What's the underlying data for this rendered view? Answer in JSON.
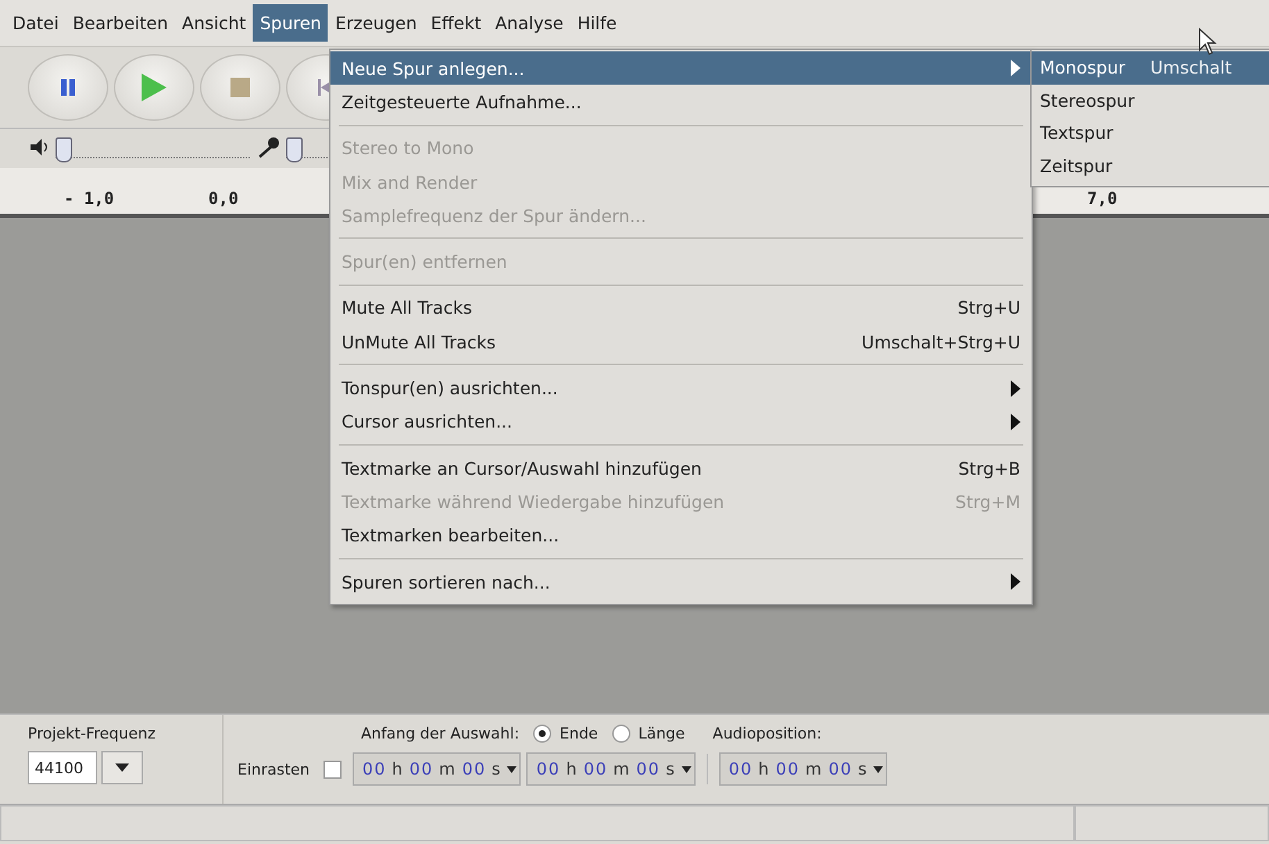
{
  "menubar": [
    {
      "label": "Datei",
      "selected": false
    },
    {
      "label": "Bearbeiten",
      "selected": false
    },
    {
      "label": "Ansicht",
      "selected": false
    },
    {
      "label": "Spuren",
      "selected": true
    },
    {
      "label": "Erzeugen",
      "selected": false
    },
    {
      "label": "Effekt",
      "selected": false
    },
    {
      "label": "Analyse",
      "selected": false
    },
    {
      "label": "Hilfe",
      "selected": false
    }
  ],
  "meters": [
    {
      "kind": "speaker",
      "level": 0
    },
    {
      "kind": "microphone",
      "level": 0
    }
  ],
  "ruler": [
    "- 1,0",
    "0,0",
    "7,0"
  ],
  "menu": [
    {
      "kind": "item",
      "label": "Neue Spur anlegen...",
      "selected": true,
      "disabled": false,
      "submenu": true
    },
    {
      "kind": "item",
      "label": "Zeitgesteuerte Aufnahme...",
      "selected": false,
      "disabled": false,
      "submenu": false
    },
    {
      "kind": "separator"
    },
    {
      "kind": "item",
      "label": "Stereo to Mono",
      "selected": false,
      "disabled": true,
      "submenu": false
    },
    {
      "kind": "item",
      "label": "Mix and Render",
      "selected": false,
      "disabled": true,
      "submenu": false
    },
    {
      "kind": "item",
      "label": "Samplefrequenz der Spur ändern...",
      "selected": false,
      "disabled": true,
      "submenu": false
    },
    {
      "kind": "separator"
    },
    {
      "kind": "item",
      "label": "Spur(en) entfernen",
      "selected": false,
      "disabled": true,
      "submenu": false
    },
    {
      "kind": "separator"
    },
    {
      "kind": "item",
      "label": "Mute All Tracks",
      "shortcut": "Strg+U",
      "selected": false,
      "disabled": false,
      "submenu": false
    },
    {
      "kind": "item",
      "label": "UnMute All Tracks",
      "shortcut": "Umschalt+Strg+U",
      "selected": false,
      "disabled": false,
      "submenu": false
    },
    {
      "kind": "separator"
    },
    {
      "kind": "item",
      "label": "Tonspur(en) ausrichten...",
      "selected": false,
      "disabled": false,
      "submenu": true
    },
    {
      "kind": "item",
      "label": "Cursor ausrichten...",
      "selected": false,
      "disabled": false,
      "submenu": true
    },
    {
      "kind": "separator"
    },
    {
      "kind": "item",
      "label": "Textmarke an Cursor/Auswahl hinzufügen",
      "shortcut": "Strg+B",
      "selected": false,
      "disabled": false,
      "submenu": false
    },
    {
      "kind": "item",
      "label": "Textmarke während Wiedergabe hinzufügen",
      "shortcut": "Strg+M",
      "selected": false,
      "disabled": true,
      "submenu": false
    },
    {
      "kind": "item",
      "label": "Textmarken bearbeiten...",
      "selected": false,
      "disabled": false,
      "submenu": false
    },
    {
      "kind": "separator"
    },
    {
      "kind": "item",
      "label": "Spuren sortieren nach...",
      "selected": false,
      "disabled": false,
      "submenu": true
    }
  ],
  "submenu": [
    {
      "label": "Monospur",
      "shortcut": "Umschalt",
      "selected": true
    },
    {
      "label": "Stereospur",
      "selected": false
    },
    {
      "label": "Textspur",
      "selected": false
    },
    {
      "label": "Zeitspur",
      "selected": false
    }
  ],
  "selection_toolbar": {
    "rate_label": "Projekt-Frequenz",
    "rate": "44100",
    "selection_label": "Anfang der Auswahl:",
    "radios": [
      {
        "label": "Ende",
        "selected": true
      },
      {
        "label": "Länge",
        "selected": false
      }
    ],
    "position_label": "Audioposition:",
    "snap_label": "Einrasten",
    "snap_checked": false,
    "times": [
      "00 h 00 m 00 s",
      "00 h 00 m 00 s",
      "00 h 00 m 00 s"
    ]
  }
}
